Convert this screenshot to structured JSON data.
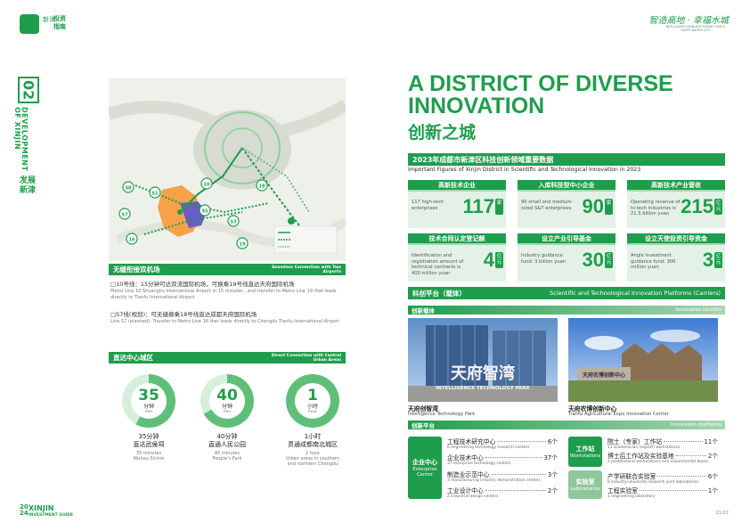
{
  "header": {
    "logo_line1": "新津",
    "logo_line2": "投资指南",
    "slogan": "智造高地 · 幸福水城",
    "slogan_sub": "INTELLIGENT MANUFACTURING HUB & HAPPY WATER CITY"
  },
  "side": {
    "number": "02",
    "en_line1": "DEVELOPMENT",
    "en_line2": "OF XINJIN",
    "cn": "发展新津"
  },
  "airport": {
    "title_cn": "无缝衔接双机场",
    "title_en": "Seamless Connection with Two Airports",
    "line1_cn": "□10号线：15分钟可达双流国际机场，可换乘19号线直达天府国际机场",
    "line1_en": "Metro Line 10 Shuangliu International Airport in 15 minutes , and transfer to Metro Line 19 that leads directly to Tianfu International Airport",
    "line2_cn": "□S7线(规划)：可无缝换乘18号线直达成都天府国际机场",
    "line2_en": "Line S7 (planned): Transfer to Metro Line 18 that leads directly to Chengdu Tianfu International Airport"
  },
  "map": {
    "labels": [
      "S8",
      "S7",
      "S1",
      "10",
      "16",
      "S5",
      "S3",
      "18",
      "19"
    ]
  },
  "urban": {
    "title_cn": "直达中心城区",
    "title_en": "Direct Connection with Central Urban Areas",
    "items": [
      {
        "num": "35",
        "unit": "分钟",
        "unit_en": "min",
        "label": "35分钟\n直达武侯祠",
        "label_en": "35 minutes\nWuhou Shrine",
        "ratio": 0.58
      },
      {
        "num": "40",
        "unit": "分钟",
        "unit_en": "min",
        "label": "40分钟\n直通人民公园",
        "label_en": "40 minutes\nPeople's Park",
        "ratio": 0.67
      },
      {
        "num": "1",
        "unit": "小时",
        "unit_en": "hour",
        "label": "1小时\n贯通成都南北城区",
        "label_en": "1 hour\nUrban areas in southern\nand northern Chengdu",
        "ratio": 1.0
      }
    ]
  },
  "guide": {
    "year": "20\n24",
    "name": "XINJIN",
    "sub": "INVESTMENT GUIDE"
  },
  "title": {
    "en": "A DISTRICT OF DIVERSE INNOVATION",
    "cn": "创新之城"
  },
  "figures": {
    "title_cn": "2023年成都市新津区科技创新领域重要数据",
    "title_en": "Important Figures of Xinjin District in Scientific and Technological Innovation in 2023",
    "cards": [
      {
        "head": "高新技术企业",
        "desc": "117 high-tech enterprises",
        "num": "117",
        "unit": "家"
      },
      {
        "head": "入库科技型中小企业",
        "desc": "90 small and medium-sized S&T enterprises",
        "num": "90",
        "unit": "家"
      },
      {
        "head": "高新技术产业营收",
        "desc": "Operating revenue of hi-tech industries is 21.5 billion yuan",
        "num": "215",
        "unit": "亿元"
      },
      {
        "head": "技术合同认定登记额",
        "desc": "Identification and registration amount of technical contracts is 400 million yuan",
        "num": "4",
        "unit": "亿元"
      },
      {
        "head": "设立产业引导基金",
        "desc": "Industry guidance fund: 3 billion yuan",
        "num": "30",
        "unit": "亿元"
      },
      {
        "head": "设立天使投资引导资金",
        "desc": "Angle investment guidance fund: 300 million yuan",
        "num": "3",
        "unit": "亿元"
      }
    ]
  },
  "platforms": {
    "title_cn": "科创平台（载体）",
    "title_en": "Scientific and Technological Innovation Platforms (Carriers)",
    "carrier_cn": "创新载体",
    "carrier_en": "Innovation carriers",
    "photo1_cn": "天府创智湾",
    "photo1_en": "Intelligence Technology Park",
    "photo1_sign": "天府智湾",
    "photo1_sign_en": "INTELLIGENCE TECHNOLOGY PARK",
    "photo2_cn": "天府农博创新中心",
    "photo2_en": "Tianfu Agricultural Expo Innovation Center",
    "photo2_sign": "天府农博创新中心",
    "innov_cn": "创新平台",
    "innov_en": "Innovation platforms",
    "center_cn": "企业中心",
    "center_en": "Enterprise\nCenter",
    "ws_cn": "工作站",
    "ws_en": "Workstations",
    "lab_cn": "实验室",
    "lab_en": "Laboratories",
    "left_list": [
      {
        "name": "工程技术研究中心",
        "count": "6个",
        "en": "6 engineering technology research centers"
      },
      {
        "name": "企业技术中心",
        "count": "37个",
        "en": "37 enterprise technology centers"
      },
      {
        "name": "制造业示范中心",
        "count": "3个",
        "en": "3 manufacturing industry demonstration centers"
      },
      {
        "name": "工业设计中心",
        "count": "2个",
        "en": "2 industrial-design centers"
      }
    ],
    "ws_list": [
      {
        "name": "院士（专家）工作站",
        "count": "11个",
        "en": "11 academician (expert) workstations"
      },
      {
        "name": "博士后工作站及实验基地",
        "count": "2个",
        "en": "2 postdoctoral workstations and experimental bases"
      }
    ],
    "lab_list": [
      {
        "name": "产学研联合实验室",
        "count": "6个",
        "en": "6 industry-university-research joint laboratories"
      },
      {
        "name": "工程实验室",
        "count": "1个",
        "en": "1 engineering laboratory"
      }
    ]
  },
  "page": {
    "number": "21/22"
  },
  "colors": {
    "brand": "#1f9d4c",
    "light": "#e3f1e6"
  }
}
